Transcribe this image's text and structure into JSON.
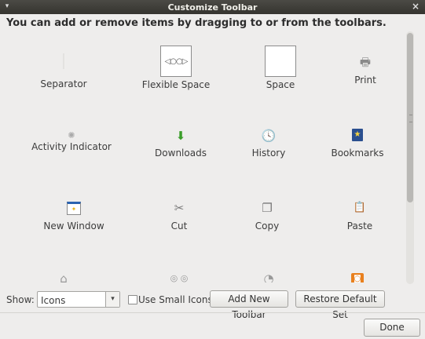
{
  "window": {
    "title": "Customize Toolbar",
    "menu_glyph": "▾",
    "close_glyph": "×"
  },
  "instructions": "You can add or remove items by dragging to or from the toolbars.",
  "items": [
    {
      "label": "Separator",
      "icon": "separator-icon"
    },
    {
      "label": "Flexible Space",
      "icon": "flexible-space-icon",
      "glyph": "◁○○▷"
    },
    {
      "label": "Space",
      "icon": "space-icon"
    },
    {
      "label": "Print",
      "icon": "printer-icon",
      "glyph": "🖶"
    },
    {
      "label": "Activity Indicator",
      "icon": "throbber-icon",
      "glyph": "✺"
    },
    {
      "label": "Downloads",
      "icon": "download-icon",
      "glyph": "⬇"
    },
    {
      "label": "History",
      "icon": "clock-icon",
      "glyph": "🕓"
    },
    {
      "label": "Bookmarks",
      "icon": "bookmark-book-icon",
      "glyph": "★"
    },
    {
      "label": "New Window",
      "icon": "new-window-icon",
      "glyph": "✦"
    },
    {
      "label": "Cut",
      "icon": "scissors-icon",
      "glyph": "✂"
    },
    {
      "label": "Copy",
      "icon": "copy-icon",
      "glyph": "❐"
    },
    {
      "label": "Paste",
      "icon": "clipboard-icon",
      "glyph": "📋"
    }
  ],
  "partial_row_glyphs": [
    "⌂",
    "◎ ◎",
    "◔",
    "◙"
  ],
  "controls": {
    "show_label": "Show:",
    "show_value": "Icons",
    "dropdown_arrow": "▾",
    "use_small_icons_label": "Use Small Icons",
    "add_toolbar_label": "Add New Toolbar",
    "restore_default_label": "Restore Default Set",
    "done_label": "Done"
  },
  "colors": {
    "titlebar": "#3f3e39",
    "background": "#eeedec",
    "downloads_accent": "#3a9d2a",
    "history_accent": "#2b63b0",
    "bookmarks_accent": "#2a4f8f",
    "rss_accent": "#e8801e"
  }
}
